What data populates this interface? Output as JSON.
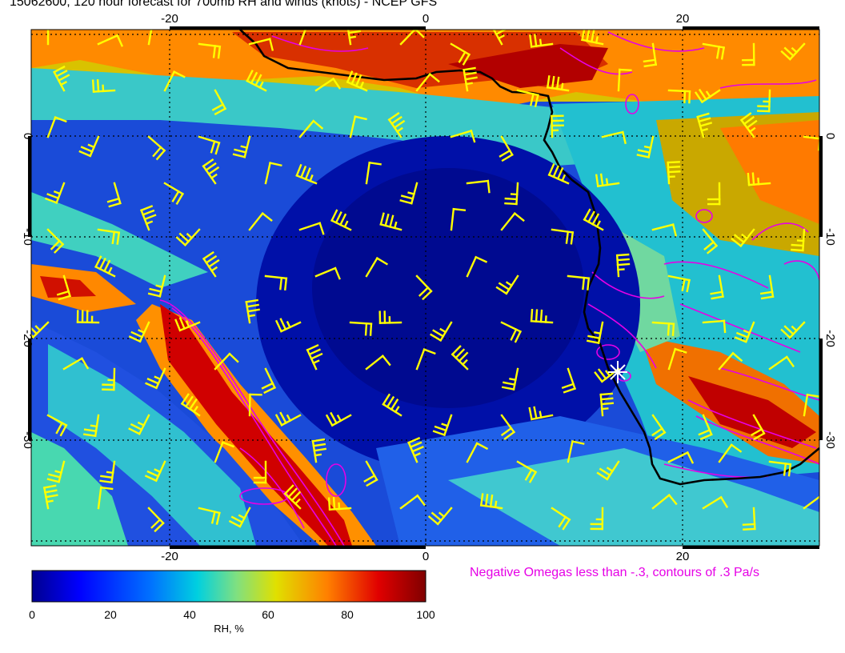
{
  "title": "15062600, 120 hour forecast for 700mb RH and winds (knots) - NCEP GFS",
  "omega_note": "Negative Omegas less than -.3, contours of .3 Pa/s",
  "map": {
    "lon_range": [
      -31,
      30
    ],
    "lat_range": [
      -40,
      9
    ],
    "lon_ticks": [
      "-20",
      "0",
      "20"
    ],
    "lat_ticks": [
      "0",
      "-10",
      "-20",
      "-30"
    ],
    "colors": {
      "coast": "#000000",
      "barbs": "#ffff00",
      "omega": "#e600e6",
      "marker": "#ffffff"
    },
    "icons": [
      "coastline",
      "wind-barb",
      "omega-contour",
      "location-star-icon"
    ]
  },
  "colorbar": {
    "label": "RH, %",
    "ticks": [
      "0",
      "20",
      "40",
      "60",
      "80",
      "100"
    ],
    "range": [
      0,
      100
    ],
    "colors": [
      "#00008f",
      "#0000ff",
      "#0070ff",
      "#00d0e0",
      "#80e080",
      "#e0e000",
      "#ff8000",
      "#e00000",
      "#800000"
    ]
  }
}
